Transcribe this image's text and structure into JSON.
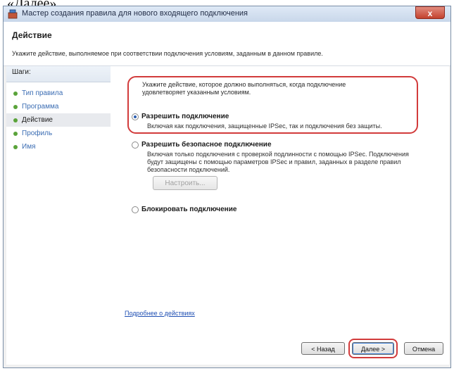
{
  "top_fragment": "«Далее».",
  "window": {
    "title": "Мастер создания правила для нового входящего подключения",
    "close_label": "x"
  },
  "header": {
    "title": "Действие",
    "description": "Укажите действие, выполняемое при соответствии подключения условиям, заданным в данном правиле."
  },
  "steps": {
    "header": "Шаги:",
    "items": [
      {
        "label": "Тип правила",
        "active": false
      },
      {
        "label": "Программа",
        "active": false
      },
      {
        "label": "Действие",
        "active": true
      },
      {
        "label": "Профиль",
        "active": false
      },
      {
        "label": "Имя",
        "active": false
      }
    ]
  },
  "main": {
    "intro": "Укажите действие, которое должно выполняться, когда подключение удовлетворяет указанным условиям.",
    "options": [
      {
        "label": "Разрешить подключение",
        "description": "Включая как подключения, защищенные IPSec, так и подключения без защиты.",
        "selected": true
      },
      {
        "label": "Разрешить безопасное подключение",
        "description": "Включая только подключения с проверкой подлинности с помощью IPSec. Подключения будут защищены с помощью параметров IPSec и правил, заданных в разделе правил безопасности подключений.",
        "selected": false
      },
      {
        "label": "Блокировать подключение",
        "description": "",
        "selected": false
      }
    ],
    "customize_button": "Настроить...",
    "more_link": "Подробнее о действиях"
  },
  "buttons": {
    "back": "< Назад",
    "next": "Далее >",
    "cancel": "Отмена"
  },
  "colors": {
    "highlight": "#d23b3b",
    "accent": "#3c7fd6",
    "step_bullet": "#5aa33a"
  }
}
